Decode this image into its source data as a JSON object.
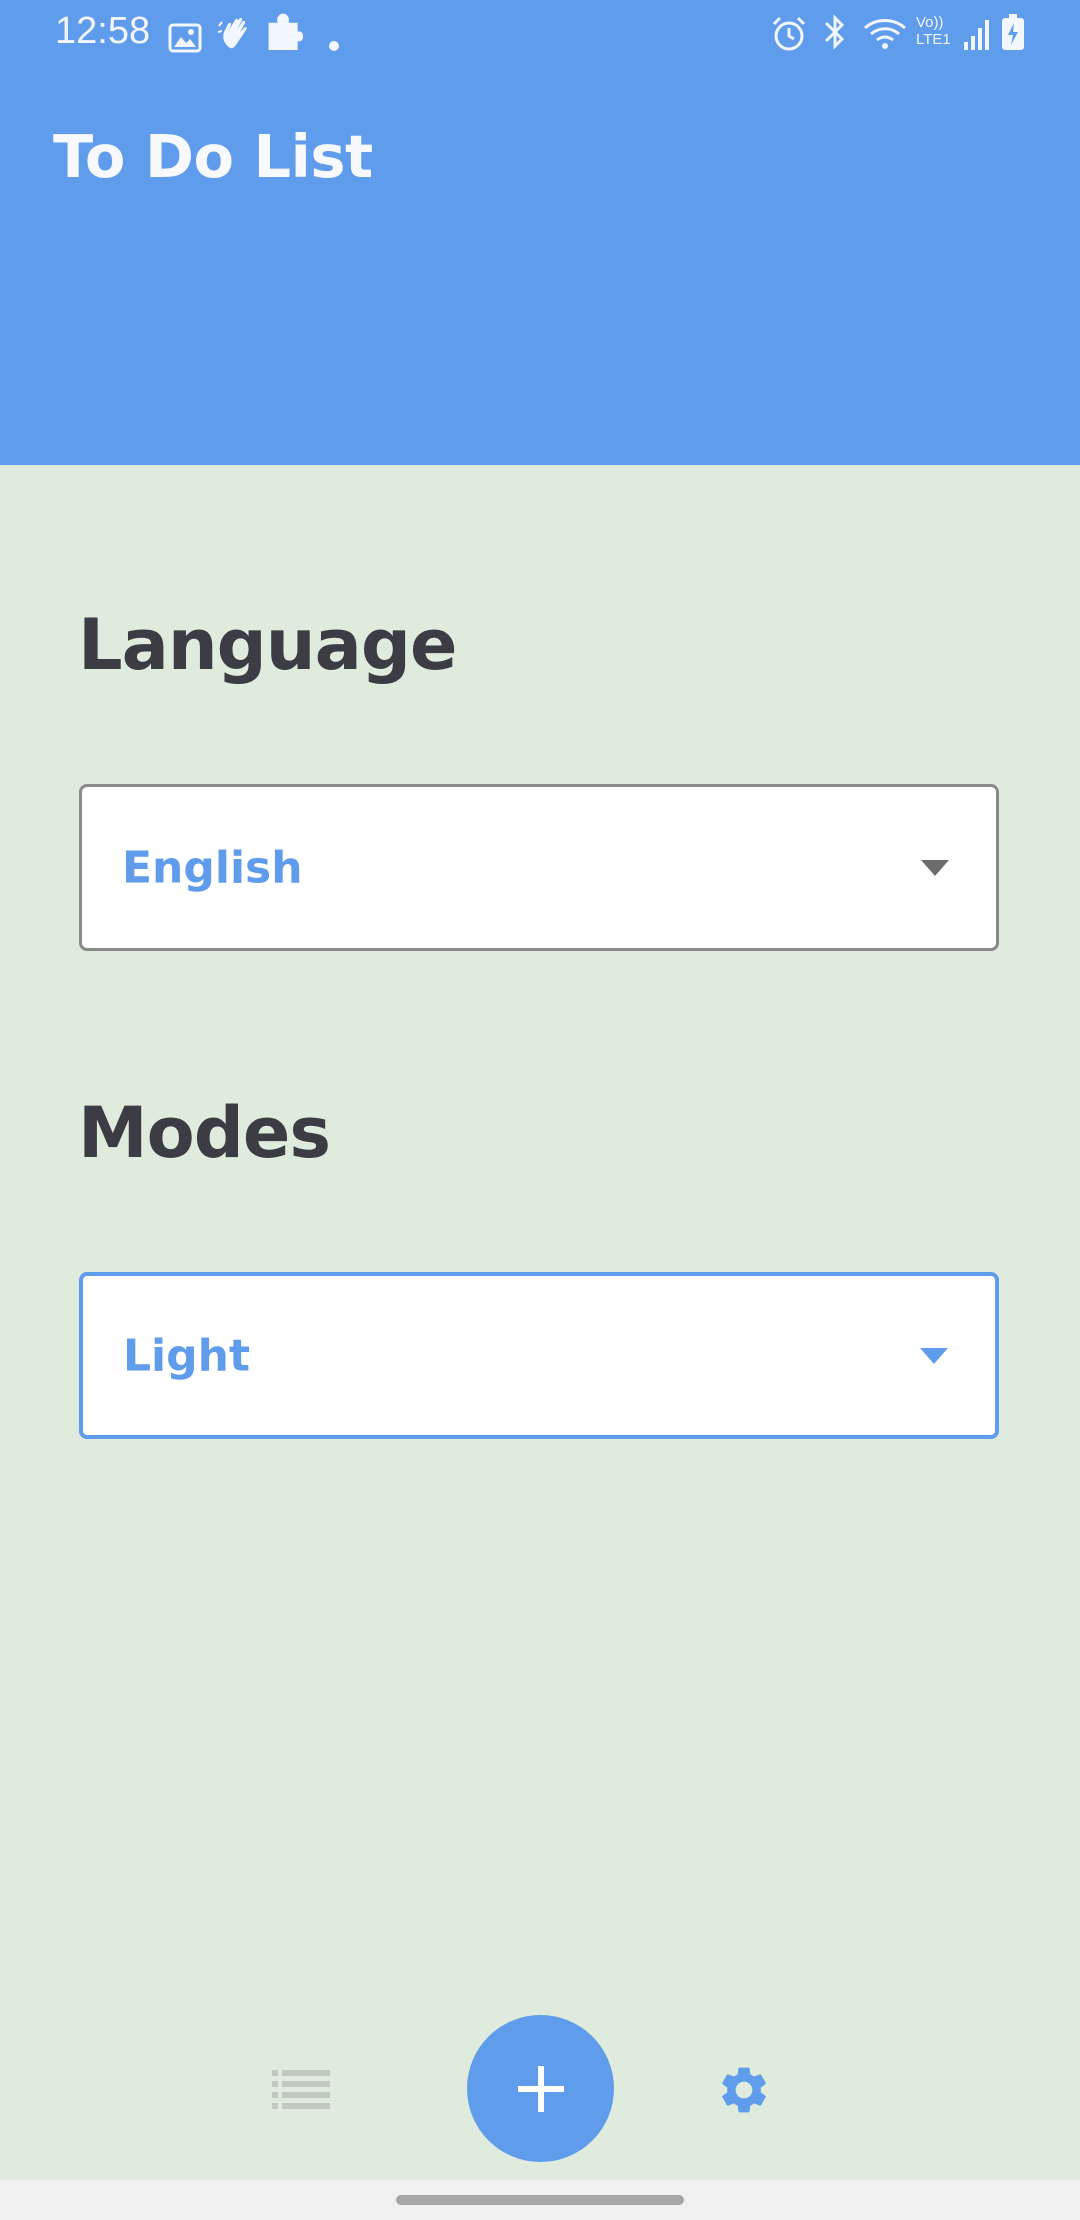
{
  "status_bar": {
    "time": "12:58",
    "left_icons": [
      "image-icon",
      "hand-wave-icon",
      "puzzle-icon",
      "dot-icon"
    ],
    "right_icons": [
      "alarm-icon",
      "bluetooth-icon",
      "wifi-icon",
      "volte-icon",
      "signal-icon",
      "battery-charging-icon"
    ],
    "volte_text": "Vo)) LTE1"
  },
  "header": {
    "title": "To Do List",
    "color": "#5f9cec"
  },
  "settings": {
    "language": {
      "heading": "Language",
      "selected": "English"
    },
    "modes": {
      "heading": "Modes",
      "selected": "Light"
    }
  },
  "bottom_nav": {
    "items": [
      {
        "icon": "list-icon"
      },
      {
        "icon": "add-icon"
      },
      {
        "icon": "settings-gear-icon"
      }
    ]
  },
  "colors": {
    "accent": "#5f9cec",
    "background": "#dfebdd",
    "heading_text": "#3c3c44"
  }
}
